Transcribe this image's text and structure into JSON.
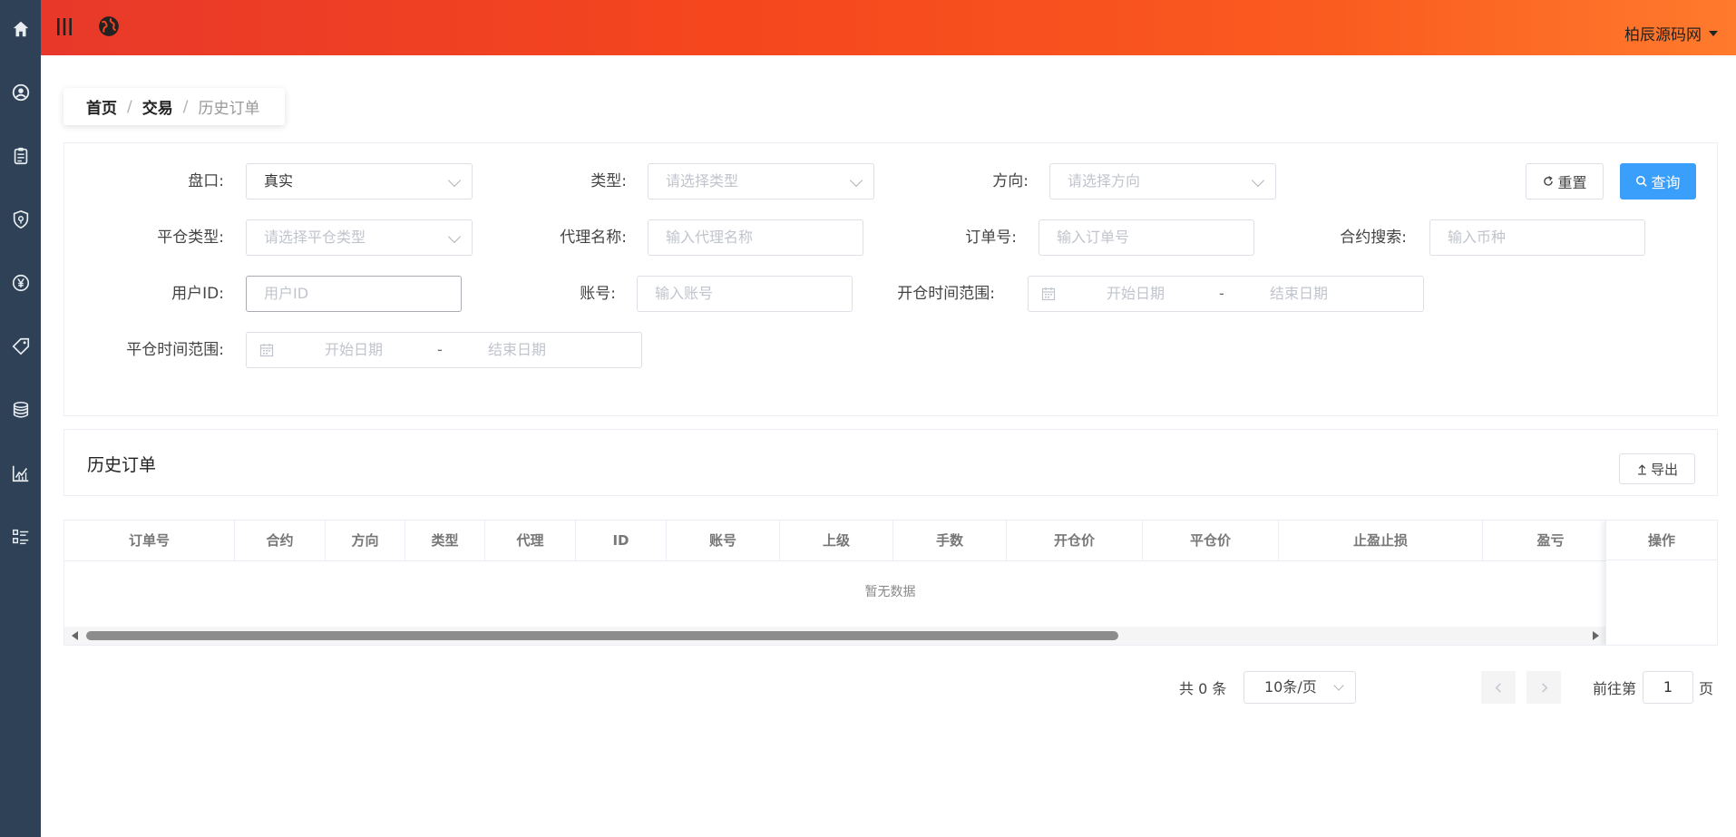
{
  "topbar": {
    "user_name": "柏辰源码网",
    "icons": [
      "menu-icon",
      "globe-icon"
    ]
  },
  "sidebar": {
    "icons": [
      "home-icon",
      "user-circle-icon",
      "clipboard-icon",
      "shield-icon",
      "yen-icon",
      "tag-icon",
      "coins-icon",
      "chart-icon",
      "list-icon"
    ]
  },
  "breadcrumb": {
    "items": [
      "首页",
      "交易",
      "历史订单"
    ],
    "separator": "/"
  },
  "filters": {
    "market_label": "盘口:",
    "market_value": "真实",
    "type_label": "类型:",
    "type_placeholder": "请选择类型",
    "direction_label": "方向:",
    "direction_placeholder": "请选择方向",
    "close_type_label": "平仓类型:",
    "close_type_placeholder": "请选择平仓类型",
    "agent_label": "代理名称:",
    "agent_placeholder": "输入代理名称",
    "order_label": "订单号:",
    "order_placeholder": "输入订单号",
    "contract_label": "合约搜索:",
    "contract_placeholder": "输入币种",
    "uid_label": "用户ID:",
    "uid_placeholder": "用户ID",
    "account_label": "账号:",
    "account_placeholder": "输入账号",
    "open_time_label": "开仓时间范围:",
    "close_time_label": "平仓时间范围:",
    "date_start": "开始日期",
    "date_end": "结束日期",
    "date_dash": "-",
    "reset_label": "重置",
    "search_label": "查询"
  },
  "list": {
    "title": "历史订单",
    "export_label": "导出"
  },
  "table": {
    "columns": [
      "订单号",
      "合约",
      "方向",
      "类型",
      "代理",
      "ID",
      "账号",
      "上级",
      "手数",
      "开仓价",
      "平仓价",
      "止盈止损",
      "盈亏"
    ],
    "fixed_column": "操作",
    "empty_text": "暂无数据"
  },
  "pagination": {
    "total_text": "共 0 条",
    "page_size": "10条/页",
    "goto_prefix": "前往第",
    "goto_page": "1",
    "goto_suffix": "页"
  },
  "colors": {
    "topbar_start": "#e8382a",
    "topbar_end": "#ff7a2c",
    "sidebar": "#2f4156",
    "primary": "#3a9ffb"
  }
}
